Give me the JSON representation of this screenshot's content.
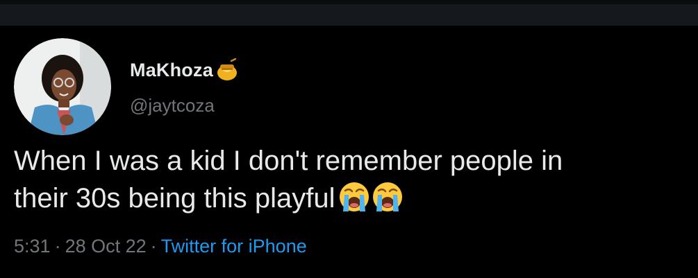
{
  "author": {
    "display_name": "MaKhoza",
    "name_badge": "honey-pot-icon",
    "handle": "@jaytcoza"
  },
  "tweet": {
    "text_line_1": "When I was a kid I don't remember people in",
    "text_line_2": "their 30s being this playful",
    "emojis": [
      "loudly-crying-face-icon",
      "loudly-crying-face-icon"
    ]
  },
  "meta": {
    "time": "5:31",
    "separator": "·",
    "date": "28 Oct 22",
    "source": "Twitter for iPhone"
  },
  "colors": {
    "background": "#000000",
    "text": "#e7e9ea",
    "muted": "#71767b",
    "link": "#1d9bf0",
    "top_bar": "#15181c"
  }
}
